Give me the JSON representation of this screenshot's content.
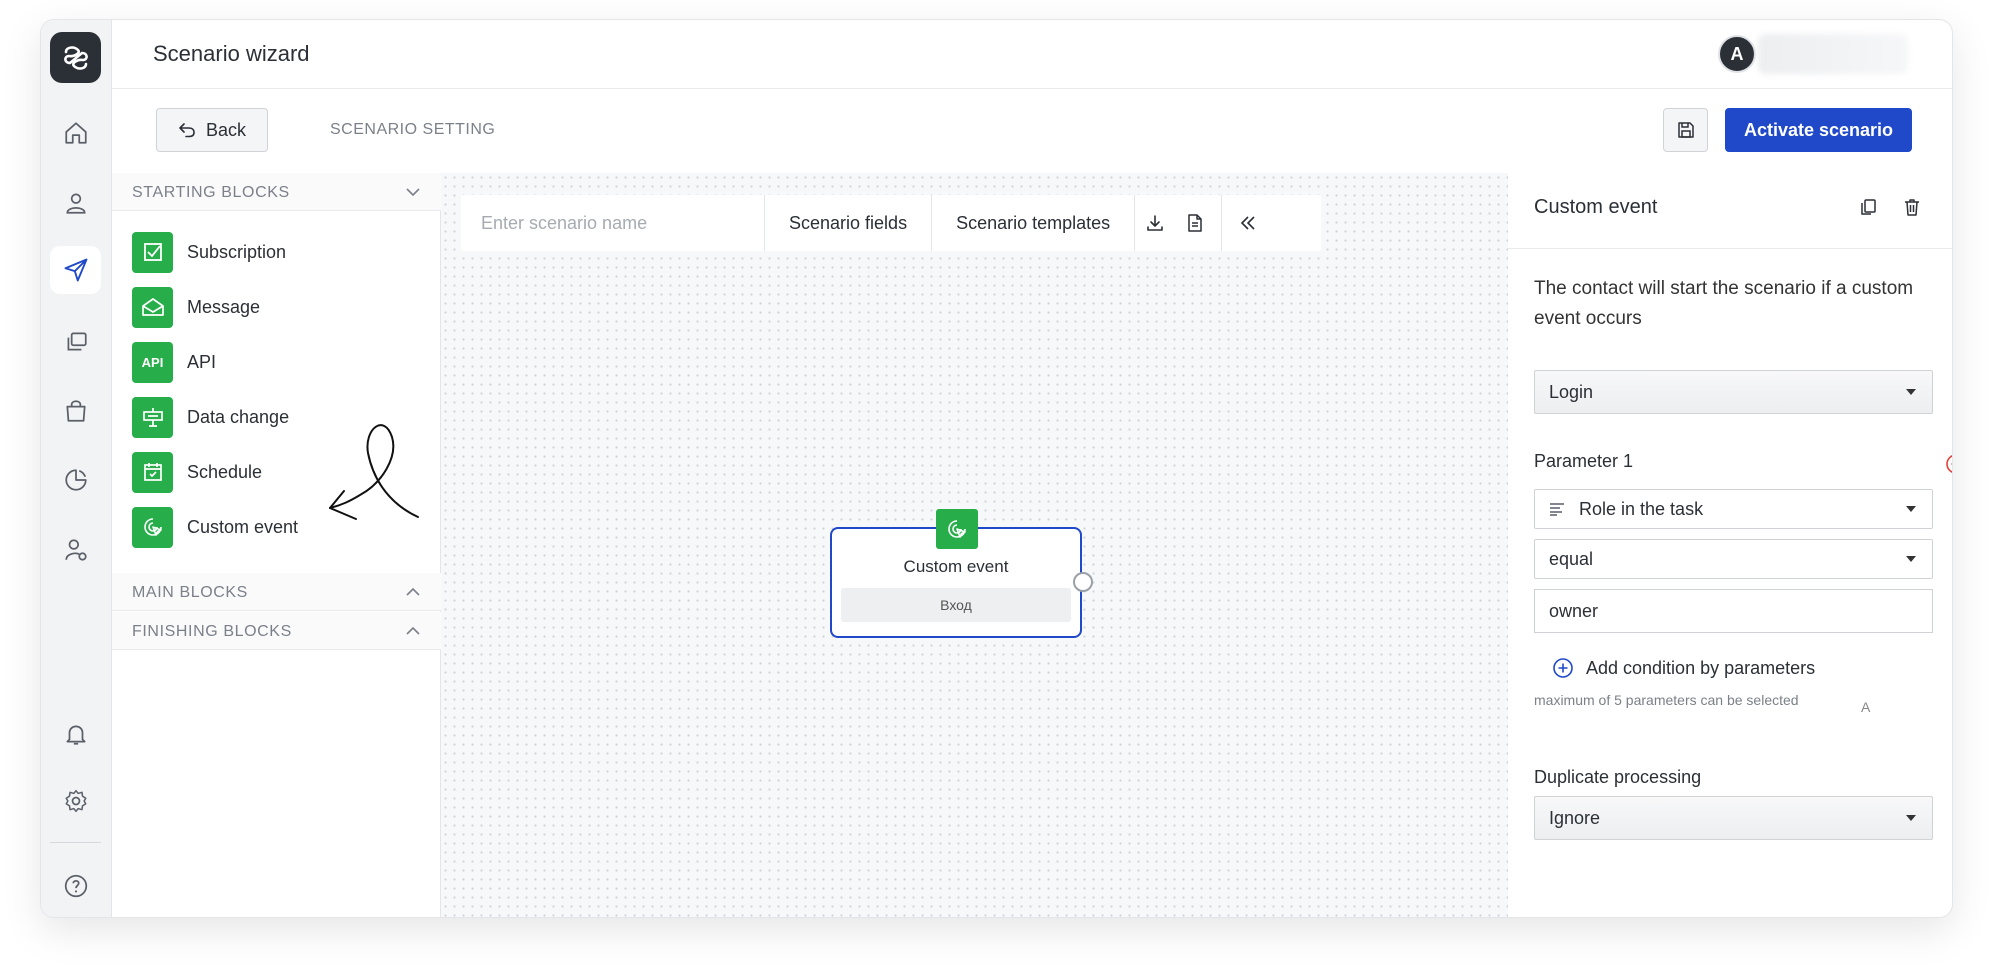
{
  "header": {
    "title": "Scenario wizard",
    "avatar_initial": "A"
  },
  "toolbar": {
    "back_label": "Back",
    "section_label": "SCENARIO SETTING",
    "activate_label": "Activate scenario"
  },
  "sidebar": {
    "items": [
      {
        "icon": "home-icon"
      },
      {
        "icon": "user-icon"
      },
      {
        "icon": "send-icon",
        "active": true
      },
      {
        "icon": "copy-icon"
      },
      {
        "icon": "shopping-bag-icon"
      },
      {
        "icon": "pie-chart-icon"
      },
      {
        "icon": "user-settings-icon"
      },
      {
        "icon": "bell-icon"
      },
      {
        "icon": "gear-icon"
      },
      {
        "icon": "help-icon"
      }
    ]
  },
  "blocks_panel": {
    "starting_title": "STARTING BLOCKS",
    "main_title": "MAIN BLOCKS",
    "finishing_title": "FINISHING BLOCKS",
    "starting_items": [
      {
        "label": "Subscription",
        "icon": "checkbox-icon"
      },
      {
        "label": "Message",
        "icon": "envelope-icon"
      },
      {
        "label": "API",
        "icon": "api-icon",
        "icon_text": "API"
      },
      {
        "label": "Data change",
        "icon": "data-change-icon"
      },
      {
        "label": "Schedule",
        "icon": "calendar-icon"
      },
      {
        "label": "Custom event",
        "icon": "cursor-click-icon"
      }
    ]
  },
  "canvas": {
    "name_placeholder": "Enter scenario name",
    "fields_label": "Scenario fields",
    "templates_label": "Scenario templates",
    "node": {
      "title": "Custom event",
      "input_label": "Вход"
    }
  },
  "props": {
    "title": "Custom event",
    "description": "The contact will start the scenario if a custom event occurs",
    "event_value": "Login",
    "param_label": "Parameter 1",
    "param_field": "Role in the task",
    "operator": "equal",
    "value": "owner",
    "add_condition_label": "Add condition by parameters",
    "side_letter": "A",
    "hint": "maximum of 5 parameters can be selected",
    "duplicate_label": "Duplicate processing",
    "duplicate_value": "Ignore"
  },
  "colors": {
    "accent": "#1f49c8",
    "green": "#27ae4a",
    "danger": "#e0453a"
  }
}
